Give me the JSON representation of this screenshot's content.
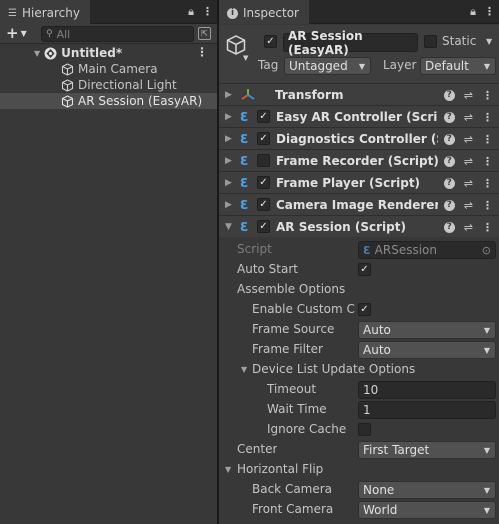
{
  "hierarchy": {
    "tab_label": "Hierarchy",
    "search_placeholder": "All",
    "scene_name": "Untitled*",
    "items": [
      {
        "label": "Main Camera",
        "selected": false
      },
      {
        "label": "Directional Light",
        "selected": false
      },
      {
        "label": "AR Session (EasyAR)",
        "selected": true
      }
    ]
  },
  "inspector": {
    "tab_label": "Inspector",
    "object_name": "AR Session (EasyAR)",
    "static_label": "Static",
    "tag_label": "Tag",
    "tag_value": "Untagged",
    "layer_label": "Layer",
    "layer_value": "Default",
    "components": [
      {
        "title": "Transform",
        "has_checkbox": false,
        "checked": false,
        "expanded": false
      },
      {
        "title": "Easy AR Controller (Script)",
        "has_checkbox": true,
        "checked": true,
        "expanded": false
      },
      {
        "title": "Diagnostics Controller (Script)",
        "has_checkbox": true,
        "checked": true,
        "expanded": false
      },
      {
        "title": "Frame Recorder (Script)",
        "has_checkbox": true,
        "checked": false,
        "expanded": false
      },
      {
        "title": "Frame Player (Script)",
        "has_checkbox": true,
        "checked": true,
        "expanded": false
      },
      {
        "title": "Camera Image Renderer (Script)",
        "has_checkbox": true,
        "checked": true,
        "expanded": false
      },
      {
        "title": "AR Session (Script)",
        "has_checkbox": true,
        "checked": true,
        "expanded": true
      }
    ],
    "ar_session": {
      "script_label": "Script",
      "script_value": "ARSession",
      "auto_start_label": "Auto Start",
      "auto_start": true,
      "assemble_options_label": "Assemble Options",
      "enable_custom_camera_label": "Enable Custom Camera",
      "enable_custom_camera": true,
      "frame_source_label": "Frame Source",
      "frame_source_value": "Auto",
      "frame_filter_label": "Frame Filter",
      "frame_filter_value": "Auto",
      "device_list_label": "Device List Update Options",
      "timeout_label": "Timeout",
      "timeout_value": "10",
      "wait_time_label": "Wait Time",
      "wait_time_value": "1",
      "ignore_cache_label": "Ignore Cache",
      "ignore_cache": false,
      "center_label": "Center",
      "center_value": "First Target",
      "horizontal_flip_label": "Horizontal Flip",
      "back_camera_label": "Back Camera",
      "back_camera_value": "None",
      "front_camera_label": "Front Camera",
      "front_camera_value": "World"
    }
  },
  "colors": {
    "panel": "#383838",
    "header": "#3e3e3e",
    "selection": "#4d4d4d",
    "script_icon": "#4aa3e6",
    "field": "#2a2a2a",
    "dropdown": "#515151"
  }
}
